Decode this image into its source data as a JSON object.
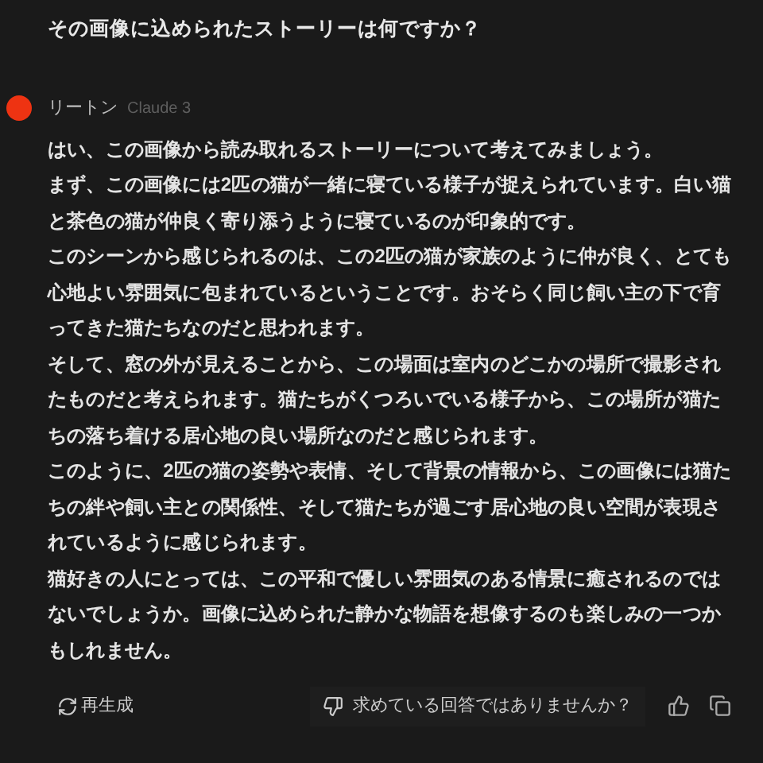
{
  "question": "その画像に込められたストーリーは何ですか？",
  "responder": {
    "name": "リートン",
    "model": "Claude 3"
  },
  "paragraphs": [
    "はい、この画像から読み取れるストーリーについて考えてみましょう。",
    "まず、この画像には2匹の猫が一緒に寝ている様子が捉えられています。白い猫と茶色の猫が仲良く寄り添うように寝ているのが印象的です。",
    "このシーンから感じられるのは、この2匹の猫が家族のように仲が良く、とても心地よい雰囲気に包まれているということです。おそらく同じ飼い主の下で育ってきた猫たちなのだと思われます。",
    "そして、窓の外が見えることから、この場面は室内のどこかの場所で撮影されたものだと考えられます。猫たちがくつろいでいる様子から、この場所が猫たちの落ち着ける居心地の良い場所なのだと感じられます。",
    "このように、2匹の猫の姿勢や表情、そして背景の情報から、この画像には猫たちの絆や飼い主との関係性、そして猫たちが過ごす居心地の良い空間が表現されているように感じられます。",
    "猫好きの人にとっては、この平和で優しい雰囲気のある情景に癒されるのではないでしょうか。画像に込められた静かな物語を想像するのも楽しみの一つかもしれません。"
  ],
  "actions": {
    "regenerate": "再生成",
    "feedback": "求めている回答ではありませんか？"
  }
}
